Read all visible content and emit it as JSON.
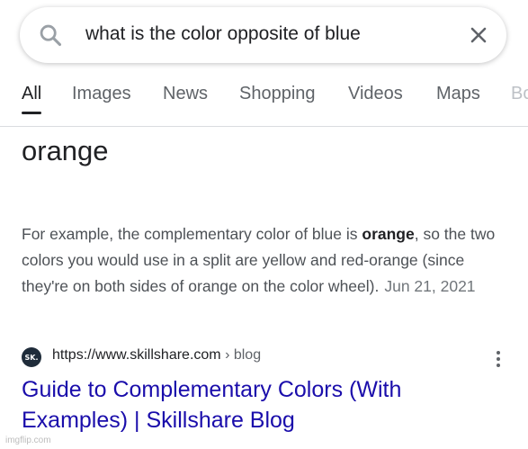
{
  "search": {
    "query": "what is the color opposite of blue"
  },
  "tabs": [
    {
      "label": "All",
      "active": true
    },
    {
      "label": "Images"
    },
    {
      "label": "News"
    },
    {
      "label": "Shopping"
    },
    {
      "label": "Videos"
    },
    {
      "label": "Maps"
    },
    {
      "label": "Bo"
    }
  ],
  "featured": {
    "answer": "orange",
    "snippet_part1": "For example, the complementary color of blue is ",
    "snippet_bold": "orange",
    "snippet_part2": ", so the two colors you would use in a split are yellow and red-orange (since they're on both sides of orange on the color wheel).",
    "date": "Jun 21, 2021"
  },
  "result": {
    "favicon_text": "SK.",
    "url": "https://www.skillshare.com",
    "crumb": "› blog",
    "title": "Guide to Complementary Colors (With Examples) | Skillshare Blog"
  },
  "watermark": "imgflip.com",
  "colors": {
    "link": "#1a0dab",
    "text": "#202124",
    "muted": "#5f6368"
  }
}
